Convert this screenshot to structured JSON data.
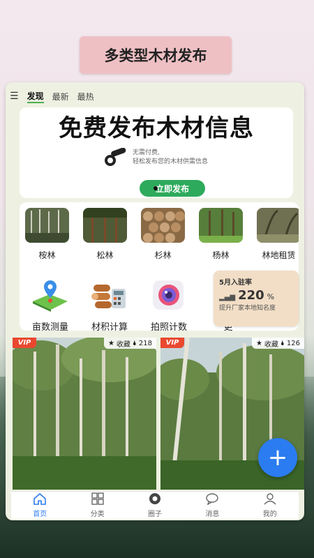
{
  "banner": {
    "title": "多类型木材发布"
  },
  "tabs": [
    "发现",
    "最新",
    "最热"
  ],
  "hero": {
    "title": "免费发布木材信息",
    "line1": "无需付费,",
    "line2": "轻松发布您的木材供需信息",
    "button": "立即发布"
  },
  "forests": [
    {
      "label": "桉林",
      "color": "#5d6a4a"
    },
    {
      "label": "松林",
      "color": "#4f5a36"
    },
    {
      "label": "杉林",
      "color": "#8a6a46"
    },
    {
      "label": "杨林",
      "color": "#577e3a"
    },
    {
      "label": "林地租赁",
      "color": "#6f6f52"
    }
  ],
  "tools": [
    {
      "label": "亩数测量",
      "icon": "map-pin-icon"
    },
    {
      "label": "材积计算",
      "icon": "log-calculator-icon"
    },
    {
      "label": "拍照计数",
      "icon": "camera-lens-icon"
    },
    {
      "label": "更",
      "icon": "more-icon"
    }
  ],
  "rate": {
    "head": "5月入驻率",
    "value": "220",
    "unit": "%",
    "desc": "提升厂家本地知名度"
  },
  "posts": [
    {
      "vip": "VIP",
      "fav": "收藏",
      "count": "218"
    },
    {
      "vip": "VIP",
      "fav": "收藏",
      "count": "126"
    }
  ],
  "fab": "+",
  "nav": [
    {
      "label": "首页",
      "icon": "home-icon",
      "active": true
    },
    {
      "label": "分类",
      "icon": "category-icon",
      "active": false
    },
    {
      "label": "圈子",
      "icon": "aperture-icon",
      "active": false
    },
    {
      "label": "消息",
      "icon": "message-icon",
      "active": false
    },
    {
      "label": "我的",
      "icon": "user-icon",
      "active": false
    }
  ],
  "colors": {
    "accent": "#2b7cf0",
    "green": "#2eaa5c",
    "vip": "#e9482f"
  }
}
